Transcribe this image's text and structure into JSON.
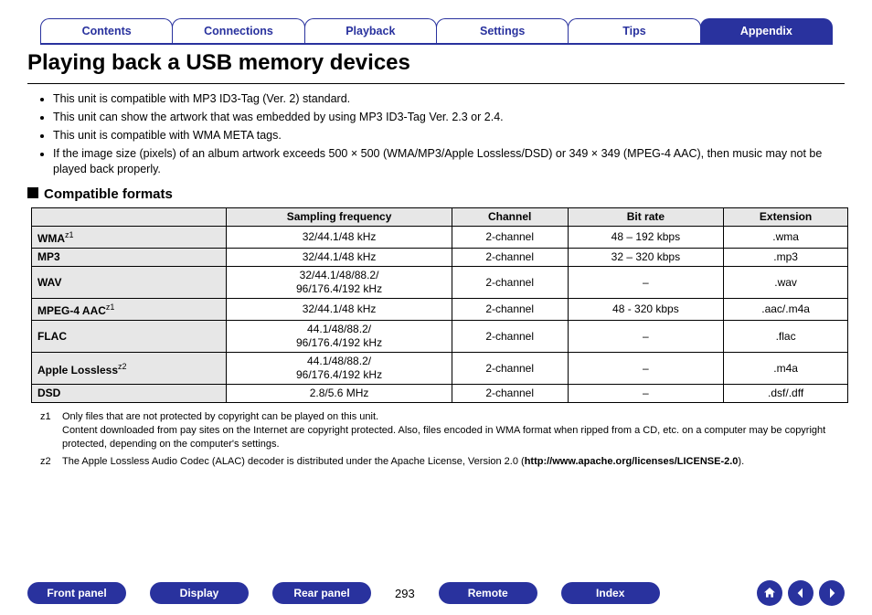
{
  "tabs": [
    {
      "label": "Contents"
    },
    {
      "label": "Connections"
    },
    {
      "label": "Playback"
    },
    {
      "label": "Settings"
    },
    {
      "label": "Tips"
    },
    {
      "label": "Appendix",
      "active": true
    }
  ],
  "title": "Playing back a USB memory devices",
  "bullets": [
    "This unit is compatible with MP3 ID3-Tag (Ver. 2) standard.",
    "This unit can show the artwork that was embedded by using MP3 ID3-Tag Ver. 2.3 or 2.4.",
    "This unit is compatible with WMA META tags.",
    "If the image size (pixels) of an album artwork exceeds 500 × 500 (WMA/MP3/Apple Lossless/DSD) or 349 × 349 (MPEG-4 AAC), then music may not be played back properly."
  ],
  "subhead": "Compatible formats",
  "table": {
    "headers": [
      "",
      "Sampling frequency",
      "Channel",
      "Bit rate",
      "Extension"
    ],
    "rows": [
      {
        "name": "WMA",
        "sup": "z1",
        "freq": "32/44.1/48 kHz",
        "ch": "2-channel",
        "rate": "48 – 192 kbps",
        "ext": ".wma"
      },
      {
        "name": "MP3",
        "sup": "",
        "freq": "32/44.1/48 kHz",
        "ch": "2-channel",
        "rate": "32 – 320 kbps",
        "ext": ".mp3"
      },
      {
        "name": "WAV",
        "sup": "",
        "freq": "32/44.1/48/88.2/\n96/176.4/192 kHz",
        "ch": "2-channel",
        "rate": "–",
        "ext": ".wav"
      },
      {
        "name": "MPEG-4 AAC",
        "sup": "z1",
        "freq": "32/44.1/48 kHz",
        "ch": "2-channel",
        "rate": "48 - 320 kbps",
        "ext": ".aac/.m4a"
      },
      {
        "name": "FLAC",
        "sup": "",
        "freq": "44.1/48/88.2/\n96/176.4/192 kHz",
        "ch": "2-channel",
        "rate": "–",
        "ext": ".flac"
      },
      {
        "name": "Apple Lossless",
        "sup": "z2",
        "freq": "44.1/48/88.2/\n96/176.4/192 kHz",
        "ch": "2-channel",
        "rate": "–",
        "ext": ".m4a"
      },
      {
        "name": "DSD",
        "sup": "",
        "freq": "2.8/5.6 MHz",
        "ch": "2-channel",
        "rate": "–",
        "ext": ".dsf/.dff"
      }
    ]
  },
  "footnotes": [
    {
      "tag": "z1",
      "text": "Only files that are not protected by copyright can be played on this unit.\nContent downloaded from pay sites on the Internet are copyright protected. Also, files encoded in WMA format when ripped from a CD, etc. on a computer may be copyright protected, depending on the computer's settings."
    },
    {
      "tag": "z2",
      "text_pre": "The Apple Lossless Audio Codec (ALAC) decoder is distributed under the Apache License, Version 2.0 (",
      "link": "http://www.apache.org/licenses/LICENSE-2.0",
      "text_post": ")."
    }
  ],
  "footer": {
    "buttons": [
      "Front panel",
      "Display",
      "Rear panel"
    ],
    "page": "293",
    "buttons2": [
      "Remote",
      "Index"
    ]
  }
}
